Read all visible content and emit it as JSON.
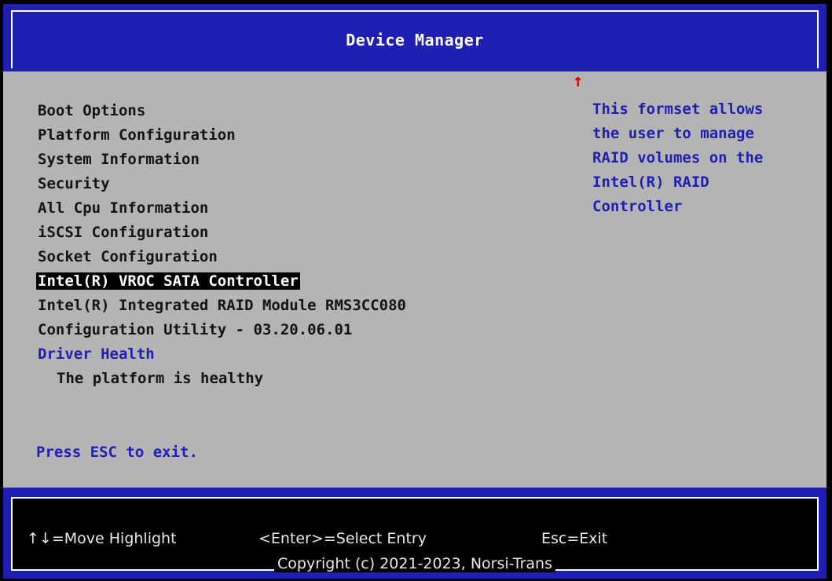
{
  "header": {
    "title": "Device Manager"
  },
  "menu": {
    "items": [
      {
        "label": "Boot Options"
      },
      {
        "label": "Platform Configuration"
      },
      {
        "label": "System Information"
      },
      {
        "label": "Security"
      },
      {
        "label": "All Cpu Information"
      },
      {
        "label": "iSCSI Configuration"
      },
      {
        "label": "Socket Configuration"
      },
      {
        "label": "Intel(R) VROC SATA Controller",
        "selected": true
      },
      {
        "label": "Intel(R) Integrated RAID Module RMS3CC080"
      },
      {
        "label": "Configuration Utility - 03.20.06.01"
      }
    ],
    "driver_health": {
      "label": "Driver Health",
      "status": "The platform is healthy"
    },
    "esc_hint": "Press ESC to exit."
  },
  "scroll_indicator": "↑",
  "help": {
    "lines": [
      "This formset allows",
      "the user to manage",
      "RAID volumes on the",
      "Intel(R) RAID",
      "Controller"
    ]
  },
  "footer": {
    "key_hints": {
      "move": "↑↓=Move Highlight",
      "select": "<Enter>=Select Entry",
      "exit": "Esc=Exit"
    },
    "copyright": "Copyright (c) 2021-2023, Norsi-Trans"
  },
  "colors": {
    "header_bg": "#1f1fb3",
    "body_bg": "#b4b4b4",
    "link_text": "#1f1fb3",
    "selected_bg": "#000000",
    "selected_text": "#ffffff",
    "scroll_arrow": "#e00000"
  }
}
